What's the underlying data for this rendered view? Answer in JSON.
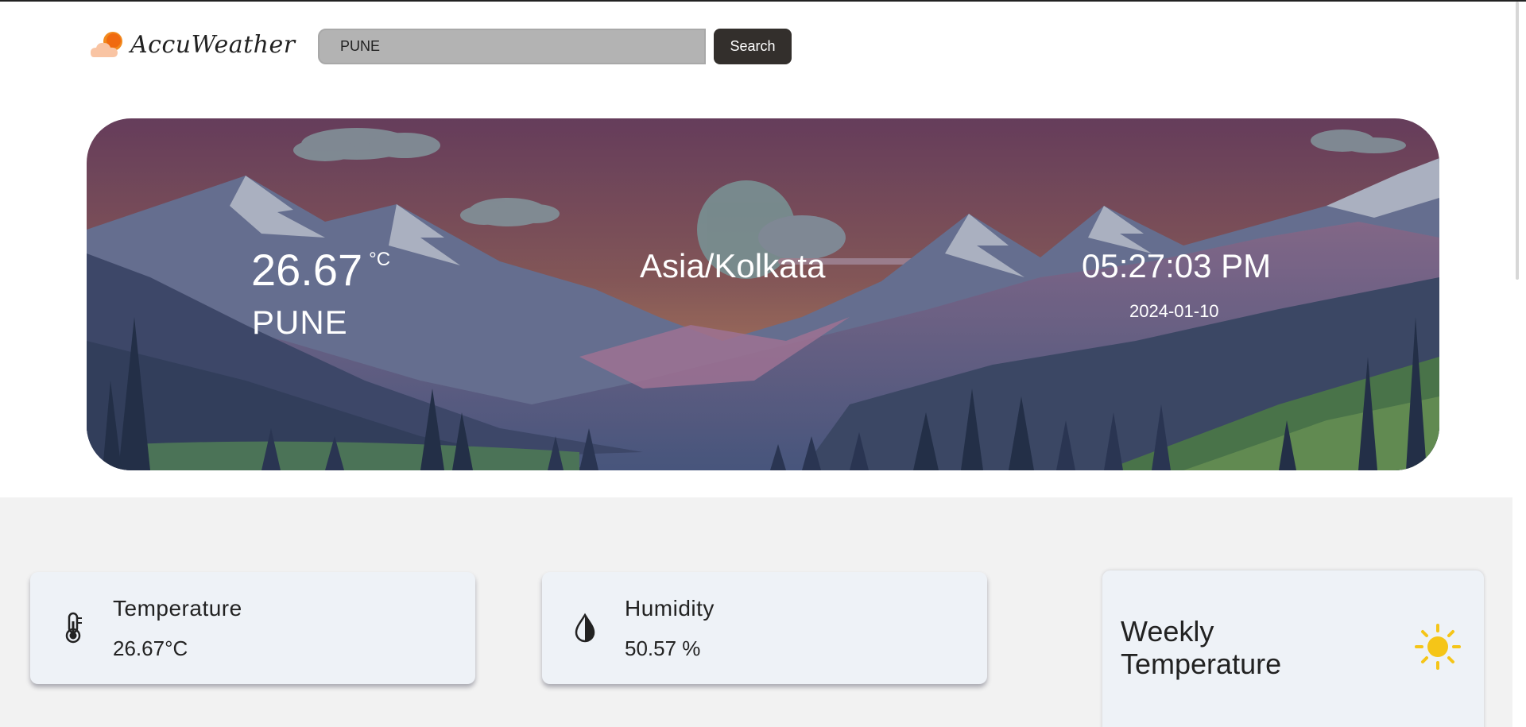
{
  "app": {
    "logo_text": "AccuWeather"
  },
  "search": {
    "value": "PUNE",
    "button_label": "Search"
  },
  "hero": {
    "temperature": "26.67",
    "temperature_unit": "°C",
    "city": "PUNE",
    "timezone": "Asia/Kolkata",
    "time": "05:27:03 PM",
    "date": "2024-01-10"
  },
  "cards": {
    "temperature": {
      "label": "Temperature",
      "value": "26.67°C",
      "icon": "thermometer-icon"
    },
    "humidity": {
      "label": "Humidity",
      "value": "50.57 %",
      "icon": "droplet-icon"
    },
    "weekly": {
      "title": "Weekly Temperature",
      "icon": "sun-icon"
    }
  },
  "colors": {
    "accent_sun": "#f5c518",
    "search_button": "#332f2c",
    "search_bg": "#b3b3b3"
  }
}
